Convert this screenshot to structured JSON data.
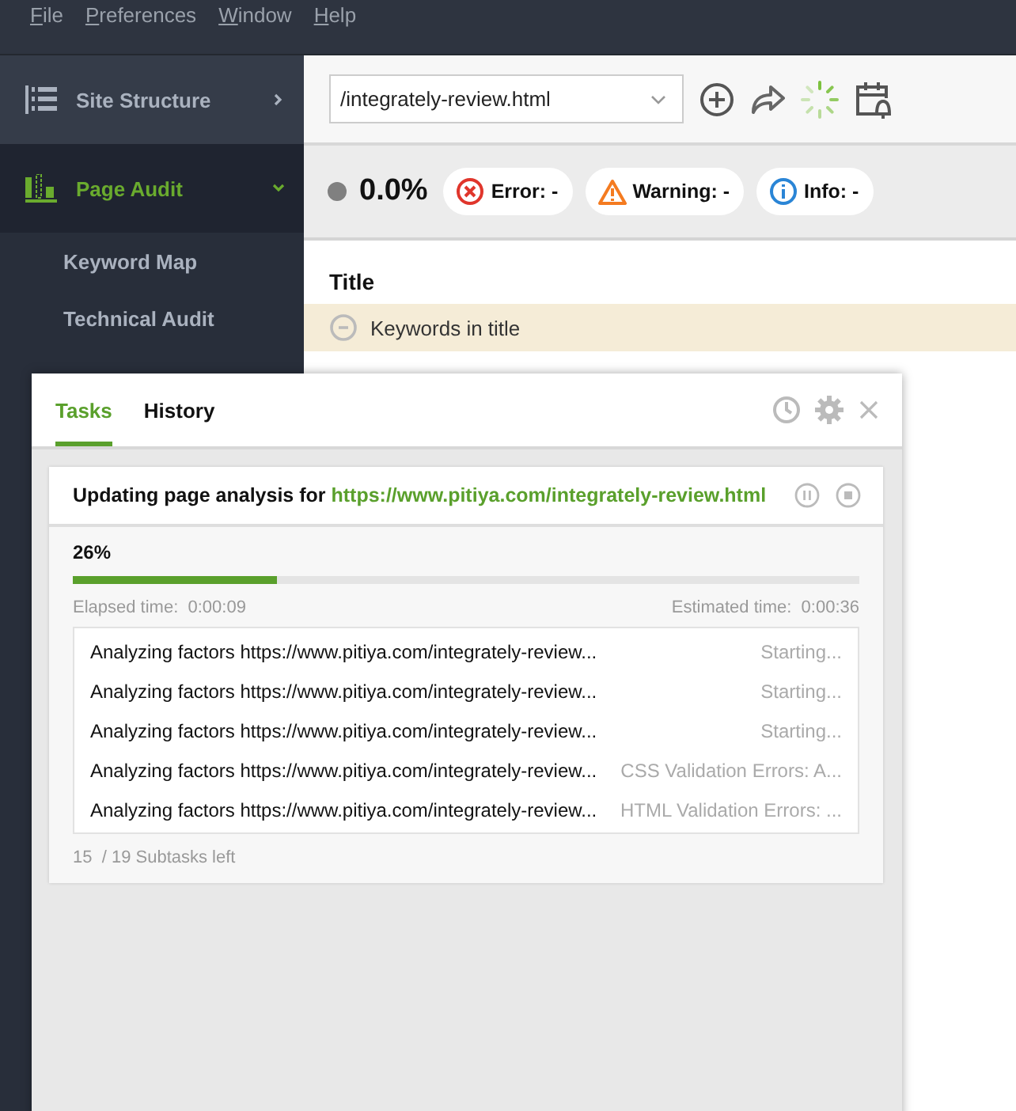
{
  "menu": [
    "File",
    "Preferences",
    "Window",
    "Help"
  ],
  "sidebar": {
    "items": [
      {
        "label": "Site Structure",
        "kind": "structure",
        "selected": false,
        "expanded": false
      },
      {
        "label": "Page Audit",
        "kind": "audit",
        "selected": true,
        "expanded": true,
        "children": [
          {
            "label": "Keyword Map"
          },
          {
            "label": "Technical Audit"
          }
        ]
      }
    ]
  },
  "toolbar": {
    "url": "/integrately-review.html"
  },
  "summary": {
    "score": "0.0%",
    "badges": [
      {
        "kind": "error",
        "label": "Error: -"
      },
      {
        "kind": "warning",
        "label": "Warning: -"
      },
      {
        "kind": "info",
        "label": "Info: -"
      }
    ]
  },
  "table": {
    "section": "Title",
    "rows": [
      {
        "label": "Keywords in title",
        "selected": true
      }
    ]
  },
  "dialog": {
    "tabs": [
      {
        "label": "Tasks",
        "selected": true
      },
      {
        "label": "History",
        "selected": false
      }
    ],
    "task": {
      "title": "Updating page analysis for ",
      "link": "https://www.pitiya.com/integrately-review.html",
      "percent": "26%",
      "level": 0.26,
      "elapsed_label": "Elapsed time:",
      "elapsed": "0:00:09",
      "estimated_label": "Estimated time:",
      "estimated": "0:00:36",
      "subtasks": [
        {
          "name": "Analyzing factors https://www.pitiya.com/integrately-review...",
          "status": "Starting..."
        },
        {
          "name": "Analyzing factors https://www.pitiya.com/integrately-review...",
          "status": "Starting..."
        },
        {
          "name": "Analyzing factors https://www.pitiya.com/integrately-review...",
          "status": "Starting..."
        },
        {
          "name": "Analyzing factors https://www.pitiya.com/integrately-review...",
          "status": "CSS Validation Errors: A..."
        },
        {
          "name": "Analyzing factors https://www.pitiya.com/integrately-review...",
          "status": "HTML Validation Errors: ..."
        }
      ],
      "left": "15  / 19 Subtasks left"
    }
  }
}
